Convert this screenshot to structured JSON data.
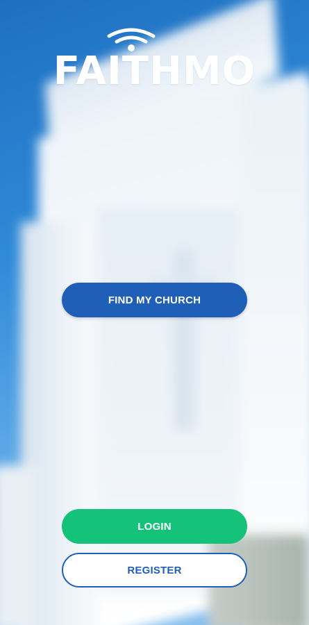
{
  "app": {
    "logo_text": "FAITHMO"
  },
  "actions": {
    "find_church_label": "FIND MY CHURCH",
    "login_label": "LOGIN",
    "register_label": "REGISTER"
  },
  "colors": {
    "primary_blue": "#1f5fb8",
    "login_green": "#14c27a",
    "white": "#ffffff"
  },
  "icons": {
    "logo_mark": "wifi-signal-icon"
  }
}
